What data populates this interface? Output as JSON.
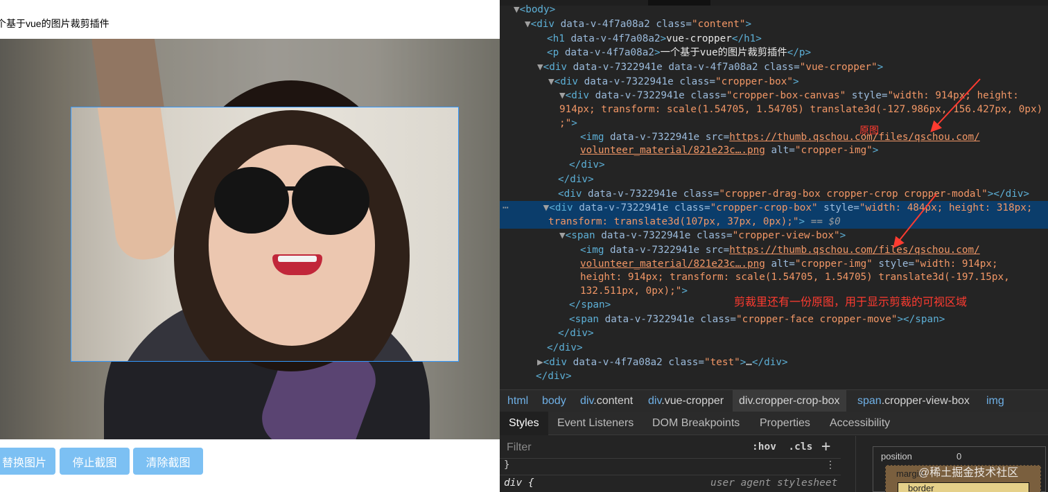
{
  "page": {
    "subtitle": "个基于vue的图片裁剪插件",
    "buttons": [
      "替换图片",
      "停止截图",
      "清除截图"
    ]
  },
  "devtools": {
    "dom": {
      "l1": {
        "tag": "body"
      },
      "l2": {
        "attrs": "data-v-4f7a08a2 class=",
        "class": "\"content\""
      },
      "l3": {
        "attrs": "data-v-4f7a08a2",
        "text": "vue-cropper"
      },
      "l4": {
        "attrs": "data-v-4f7a08a2",
        "text": "一个基于vue的图片裁剪插件"
      },
      "l5": {
        "attrs": "data-v-7322941e data-v-4f7a08a2 class=",
        "class": "\"vue-cropper\""
      },
      "l6": {
        "attrs": "data-v-7322941e class=",
        "class": "\"cropper-box\""
      },
      "l7": {
        "attrs": "data-v-7322941e class=",
        "class": "\"cropper-box-canvas\"",
        "style_attr": " style=",
        "style_a": "\"width: 914px; height:"
      },
      "l8": {
        "style_b": "914px; transform: scale(1.54705, 1.54705) translate3d(-127.986px, 156.427px, 0px)"
      },
      "l9": {
        "style_c": ";\""
      },
      "l10": {
        "attrs": "data-v-7322941e src=",
        "src": "https://thumb.qschou.com/files/qschou.com/"
      },
      "l11": {
        "src2": "volunteer_material/821e23c….png",
        "alt_attr": " alt=",
        "alt": "\"cropper-img\""
      },
      "l12": {
        "tag": "div"
      },
      "l13": {
        "tag": "div"
      },
      "l14": {
        "attrs": "data-v-7322941e class=",
        "class": "\"cropper-drag-box cropper-crop cropper-modal\""
      },
      "l15": {
        "attrs": "data-v-7322941e class=",
        "class": "\"cropper-crop-box\"",
        "style_attr": " style=",
        "style_a": "\"width: 484px; height: 318px;"
      },
      "l16": {
        "style_b": "transform: translate3d(107px, 37px, 0px);\"",
        "suffix": " == $0"
      },
      "l17": {
        "attrs": "data-v-7322941e class=",
        "class": "\"cropper-view-box\""
      },
      "l18": {
        "attrs": "data-v-7322941e src=",
        "src": "https://thumb.qschou.com/files/qschou.com/"
      },
      "l19": {
        "src2": "volunteer_material/821e23c….png",
        "alt_attr": " alt=",
        "alt": "\"cropper-img\"",
        "style_attr": " style=",
        "style_a": "\"width: 914px;"
      },
      "l20": {
        "style_b": "height: 914px; transform: scale(1.54705, 1.54705) translate3d(-197.15px,"
      },
      "l21": {
        "style_c": "132.511px, 0px);\""
      },
      "l22": {
        "tag": "span"
      },
      "l23": {
        "attrs": "data-v-7322941e class=",
        "class": "\"cropper-face cropper-move\""
      },
      "l24": {
        "tag": "div"
      },
      "l25": {
        "tag": "div"
      },
      "l26": {
        "attrs": "data-v-4f7a08a2 class=",
        "class": "\"test\"",
        "ellipsis": "…"
      },
      "l27": {
        "tag": "div"
      }
    },
    "annotations": {
      "original": "原图",
      "crop_note": "剪裁里还有一份原图，用于显示剪裁的可视区域"
    },
    "breadcrumbs": [
      {
        "tag": "html",
        "cls": ""
      },
      {
        "tag": "body",
        "cls": ""
      },
      {
        "tag": "div",
        "cls": ".content"
      },
      {
        "tag": "div",
        "cls": ".vue-cropper"
      },
      {
        "tag": "div",
        "cls": ".cropper-crop-box"
      },
      {
        "tag": "span",
        "cls": ".cropper-view-box"
      },
      {
        "tag": "img",
        "cls": ""
      }
    ],
    "tabs": [
      "Styles",
      "Event Listeners",
      "DOM Breakpoints",
      "Properties",
      "Accessibility"
    ],
    "styles": {
      "filter": "Filter",
      "hov_cls": ":hov  .cls",
      "plus": "+",
      "brace": "}",
      "dots": "⋮",
      "selector": "div {",
      "source": "user agent stylesheet"
    },
    "boxmodel": {
      "position": "position",
      "position_value": "0",
      "margin": "margin",
      "border": "border"
    },
    "watermark": "@稀土掘金技术社区"
  }
}
